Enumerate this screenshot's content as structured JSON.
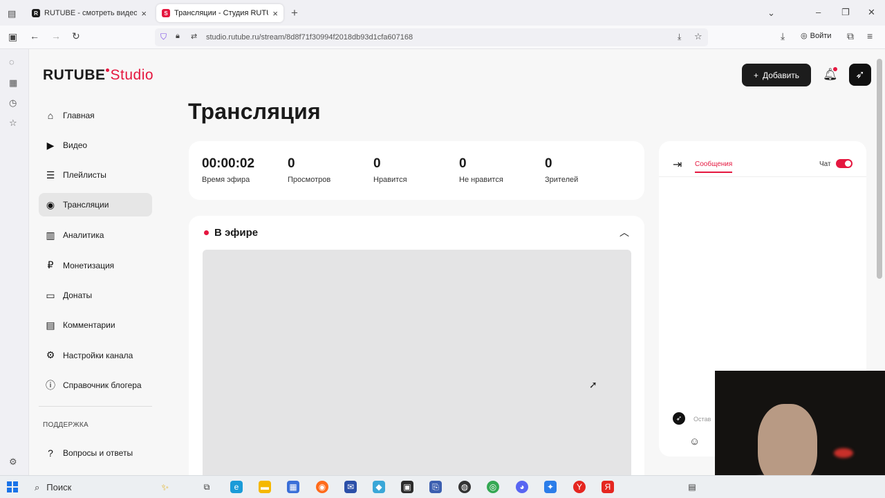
{
  "browser": {
    "tabs": [
      {
        "title": "RUTUBE - смотреть видео онл",
        "favicon_color": "#1c1c1c",
        "favicon": "R"
      },
      {
        "title": "Трансляции - Студия RUTUBE",
        "favicon_color": "#e5173f",
        "favicon": "S"
      }
    ],
    "url": "studio.rutube.ru/stream/8d8f71f30994f2018db93d1cfa607168",
    "login_label": "Войти"
  },
  "logo": {
    "main": "RUTUBE",
    "sub": "Studio"
  },
  "menu": [
    {
      "label": "Главная",
      "icon": "home-icon",
      "glyph": "⌂"
    },
    {
      "label": "Видео",
      "icon": "video-icon",
      "glyph": "▶"
    },
    {
      "label": "Плейлисты",
      "icon": "playlist-icon",
      "glyph": "☰"
    },
    {
      "label": "Трансляции",
      "icon": "broadcast-icon",
      "glyph": "◉",
      "active": true
    },
    {
      "label": "Аналитика",
      "icon": "analytics-icon",
      "glyph": "▥"
    },
    {
      "label": "Монетизация",
      "icon": "ruble-icon",
      "glyph": "₽"
    },
    {
      "label": "Донаты",
      "icon": "wallet-icon",
      "glyph": "▭"
    },
    {
      "label": "Комментарии",
      "icon": "comment-icon",
      "glyph": "▤"
    },
    {
      "label": "Настройки канала",
      "icon": "gear-icon",
      "glyph": "⚙"
    },
    {
      "label": "Справочник блогера",
      "icon": "info-icon",
      "glyph": "ⓘ"
    }
  ],
  "support": {
    "heading": "ПОДДЕРЖКА",
    "faq": "Вопросы и ответы"
  },
  "header": {
    "add_label": "Добавить"
  },
  "page_title": "Трансляция",
  "stats": [
    {
      "value": "00:00:02",
      "label": "Время эфира"
    },
    {
      "value": "0",
      "label": "Просмотров"
    },
    {
      "value": "0",
      "label": "Нравится"
    },
    {
      "value": "0",
      "label": "Не нравится"
    },
    {
      "value": "0",
      "label": "Зрителей"
    }
  ],
  "live": {
    "label": "В эфире"
  },
  "chat": {
    "tab": "Сообщения",
    "toggle_label": "Чат",
    "toggle_on": true,
    "placeholder": "Остав"
  },
  "taskbar": {
    "search": "Поиск"
  },
  "colors": {
    "accent": "#e5173f",
    "dark": "#1c1c1c"
  }
}
